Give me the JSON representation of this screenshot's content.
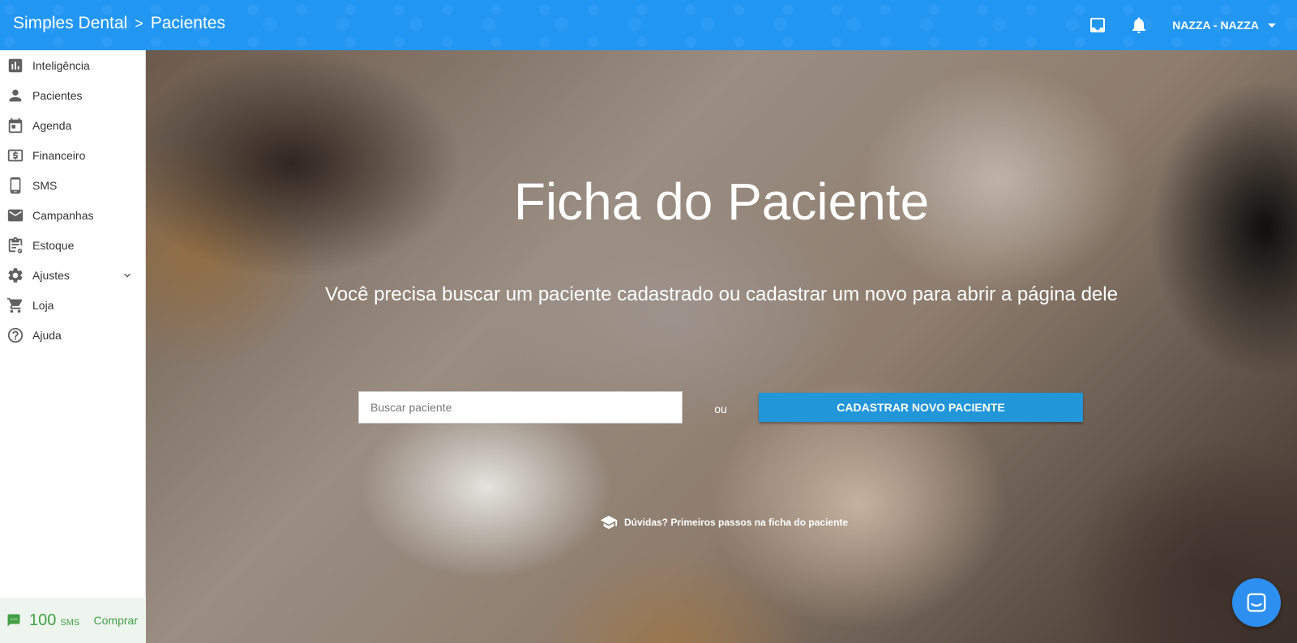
{
  "header": {
    "app_name": "Simples Dental",
    "separator": ">",
    "page_name": "Pacientes",
    "user_label": "NAZZA - NAZZA",
    "icons": [
      "inbox-icon",
      "bell-icon",
      "caret-down-icon"
    ]
  },
  "sidebar": {
    "items": [
      {
        "label": "Inteligência",
        "icon": "bar-chart-icon"
      },
      {
        "label": "Pacientes",
        "icon": "person-icon"
      },
      {
        "label": "Agenda",
        "icon": "calendar-icon"
      },
      {
        "label": "Financeiro",
        "icon": "money-icon"
      },
      {
        "label": "SMS",
        "icon": "phone-icon"
      },
      {
        "label": "Campanhas",
        "icon": "mail-icon"
      },
      {
        "label": "Estoque",
        "icon": "clipboard-icon"
      },
      {
        "label": "Ajustes",
        "icon": "gear-icon"
      },
      {
        "label": "Loja",
        "icon": "cart-icon"
      },
      {
        "label": "Ajuda",
        "icon": "help-icon"
      }
    ],
    "sms": {
      "count": "100",
      "unit": "SMS",
      "buy_label": "Comprar"
    }
  },
  "main": {
    "title": "Ficha do Paciente",
    "subtitle": "Você precisa buscar um paciente cadastrado ou cadastrar um novo para abrir a página dele",
    "search_placeholder": "Buscar paciente",
    "or_label": "ou",
    "new_patient_button": "CADASTRAR NOVO PACIENTE",
    "help_link": "Dúvidas? Primeiros passos na ficha do paciente"
  },
  "colors": {
    "primary": "#2196f3",
    "button": "#2196d9",
    "sms_green": "#43a047"
  }
}
